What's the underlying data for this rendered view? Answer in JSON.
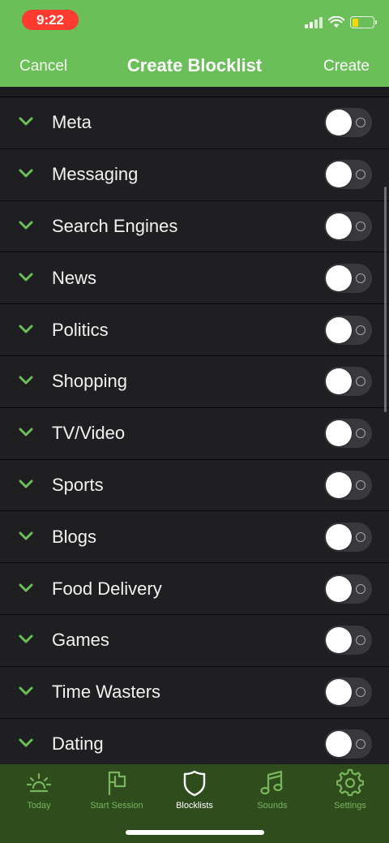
{
  "status_bar": {
    "time": "9:22"
  },
  "nav": {
    "cancel": "Cancel",
    "title": "Create Blocklist",
    "create": "Create"
  },
  "categories": [
    {
      "label": "Meta",
      "enabled": false
    },
    {
      "label": "Messaging",
      "enabled": false
    },
    {
      "label": "Search Engines",
      "enabled": false
    },
    {
      "label": "News",
      "enabled": false
    },
    {
      "label": "Politics",
      "enabled": false
    },
    {
      "label": "Shopping",
      "enabled": false
    },
    {
      "label": "TV/Video",
      "enabled": false
    },
    {
      "label": "Sports",
      "enabled": false
    },
    {
      "label": "Blogs",
      "enabled": false
    },
    {
      "label": "Food Delivery",
      "enabled": false
    },
    {
      "label": "Games",
      "enabled": false
    },
    {
      "label": "Time Wasters",
      "enabled": false
    },
    {
      "label": "Dating",
      "enabled": false
    }
  ],
  "tabs": [
    {
      "label": "Today",
      "icon": "sunrise-icon",
      "active": false
    },
    {
      "label": "Start Session",
      "icon": "flag-icon",
      "active": false
    },
    {
      "label": "Blocklists",
      "icon": "shield-icon",
      "active": true
    },
    {
      "label": "Sounds",
      "icon": "music-note-icon",
      "active": false
    },
    {
      "label": "Settings",
      "icon": "gear-icon",
      "active": false
    }
  ],
  "colors": {
    "accent_green": "#6bbf59",
    "tabbar_bg": "#2f4d1c",
    "row_bg": "#1f1f21",
    "time_pill": "#ff3b30"
  }
}
